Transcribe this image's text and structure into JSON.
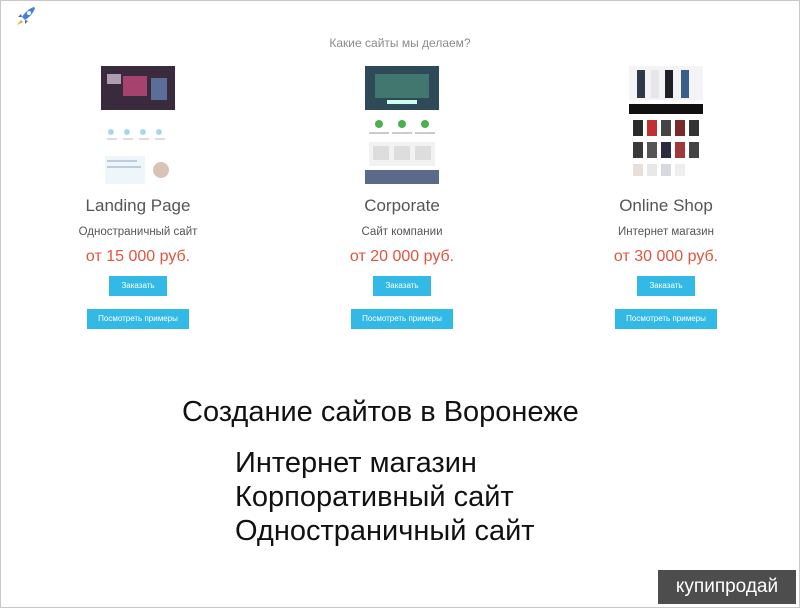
{
  "header": {
    "section_heading": "Какие сайты мы делаем?"
  },
  "cards": [
    {
      "title": "Landing Page",
      "subtitle": "Одностраничный сайт",
      "price": "от 15 000 руб.",
      "order_label": "Заказать",
      "examples_label": "Посмотреть примеры"
    },
    {
      "title": "Corporate",
      "subtitle": "Сайт компании",
      "price": "от 20 000 руб.",
      "order_label": "Заказать",
      "examples_label": "Посмотреть примеры"
    },
    {
      "title": "Online Shop",
      "subtitle": "Интернет магазин",
      "price": "от 30 000 руб.",
      "order_label": "Заказать",
      "examples_label": "Посмотреть примеры"
    }
  ],
  "promo": {
    "headline": "Создание сайтов в Воронеже",
    "items": [
      "Интернет магазин",
      "Корпоративный сайт",
      "Одностраничный сайт"
    ]
  },
  "watermark": {
    "text": "купипродай"
  },
  "colors": {
    "accent": "#33b9e6",
    "price": "#e5533d"
  }
}
